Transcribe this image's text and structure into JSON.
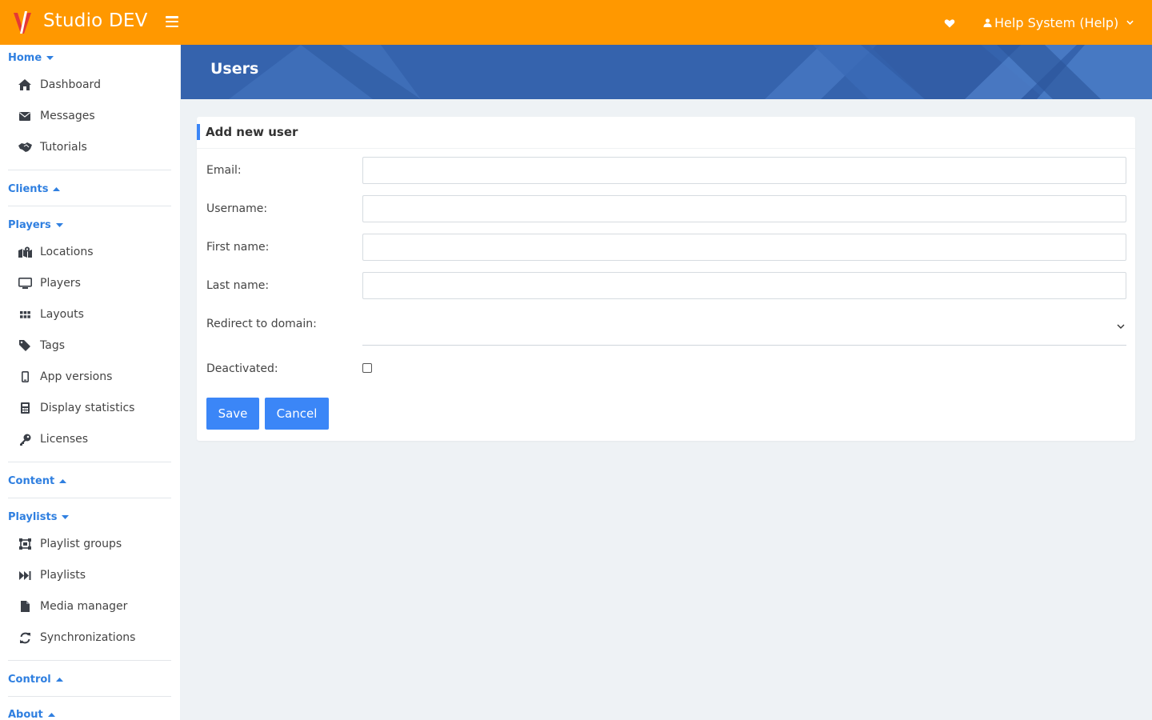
{
  "app": {
    "title": "Studio DEV"
  },
  "topbar": {
    "user_label": "Help System (Help)"
  },
  "sidebar": {
    "sections": [
      {
        "label": "Home",
        "expanded": true,
        "items": [
          "Dashboard",
          "Messages",
          "Tutorials"
        ]
      },
      {
        "label": "Clients",
        "expanded": false,
        "items": []
      },
      {
        "label": "Players",
        "expanded": true,
        "items": [
          "Locations",
          "Players",
          "Layouts",
          "Tags",
          "App versions",
          "Display statistics",
          "Licenses"
        ]
      },
      {
        "label": "Content",
        "expanded": false,
        "items": []
      },
      {
        "label": "Playlists",
        "expanded": true,
        "items": [
          "Playlist groups",
          "Playlists",
          "Media manager",
          "Synchronizations"
        ]
      },
      {
        "label": "Control",
        "expanded": false,
        "items": []
      },
      {
        "label": "About",
        "expanded": false,
        "items": []
      }
    ]
  },
  "banner": {
    "title": "Users"
  },
  "form": {
    "title": "Add new user",
    "email_label": "Email:",
    "email_value": "",
    "username_label": "Username:",
    "username_value": "",
    "first_name_label": "First name:",
    "first_name_value": "",
    "last_name_label": "Last name:",
    "last_name_value": "",
    "redirect_label": "Redirect to domain:",
    "redirect_value": "",
    "deactivated_label": "Deactivated:",
    "deactivated_checked": false,
    "save_label": "Save",
    "cancel_label": "Cancel"
  },
  "colors": {
    "accent": "#ff9800",
    "primary": "#3b86f7",
    "link": "#2f7fe0",
    "banner": "#3563ad"
  }
}
